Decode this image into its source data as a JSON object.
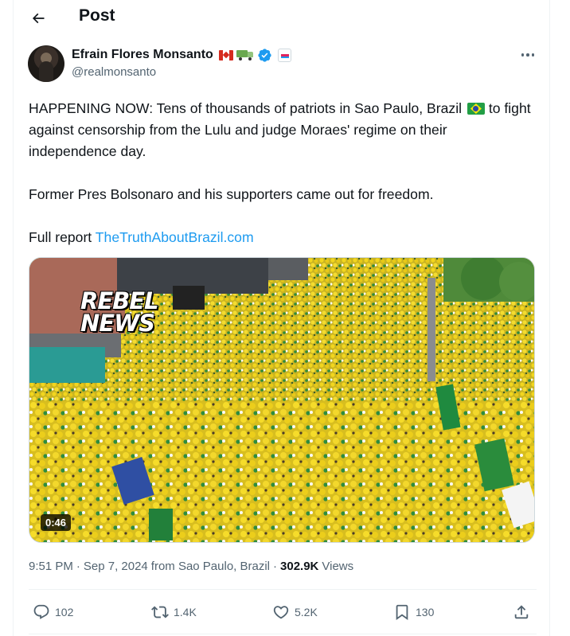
{
  "header": {
    "title": "Post",
    "back_icon": "arrow-left-icon"
  },
  "author": {
    "display_name": "Efrain Flores Monsanto",
    "handle": "@realmonsanto",
    "badges": [
      "canada-flag-icon",
      "truck-icon",
      "verified-badge-icon",
      "affiliate-badge-icon"
    ],
    "verified_color": "#1d9bf0"
  },
  "post": {
    "line1": "HAPPENING NOW: Tens of thousands of patriots in Sao Paulo, Brazil",
    "line1_emoji": "brazil-flag-icon",
    "line2": "to fight against censorship from the Lulu and judge Moraes' regime on their independence day.",
    "paragraph2": "Former Pres Bolsonaro and his supporters came out for freedom.",
    "paragraph3_prefix": "Full report ",
    "link_text": "TheTruthAboutBrazil.com"
  },
  "media": {
    "watermark_line1": "REBEL",
    "watermark_line2": "NEWS",
    "duration": "0:46"
  },
  "meta": {
    "time": "9:51 PM",
    "separator": "·",
    "date": "Sep 7, 2024",
    "location": "from Sao Paulo, Brazil",
    "views_count": "302.9K",
    "views_label": "Views"
  },
  "actions": {
    "replies": "102",
    "reposts": "1.4K",
    "likes": "5.2K",
    "bookmarks": "130"
  },
  "colors": {
    "text_primary": "#0f1419",
    "text_secondary": "#536471",
    "link": "#1d9bf0",
    "border": "#eff3f4"
  }
}
